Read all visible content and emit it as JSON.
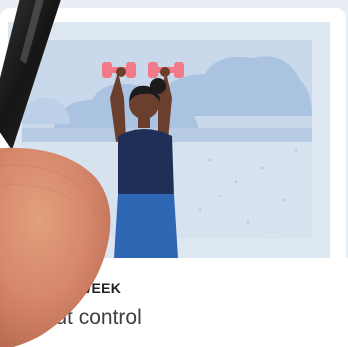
{
  "card": {
    "eyebrow": "WEEK",
    "title": "bout control"
  },
  "illustration": {
    "colors": {
      "sky": "#c9d8ea",
      "clouds": "#a9c3e0",
      "cloud_dark": "#8eadd2",
      "ground": "#d7e2ef",
      "dumbbell": "#f27a88",
      "shirt": "#1f2f57",
      "pants": "#2f67b4",
      "skin": "#6b3f2e",
      "hair": "#1b1b1b"
    }
  }
}
